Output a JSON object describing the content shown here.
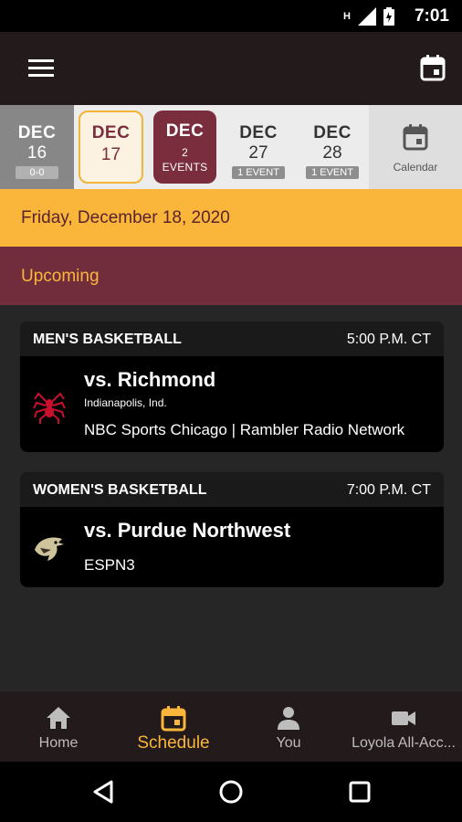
{
  "status_bar": {
    "time": "7:01",
    "network": "H"
  },
  "date_strip": [
    {
      "month": "DEC",
      "day": "16",
      "badge": "0-0"
    },
    {
      "month": "DEC",
      "day": "17",
      "badge": ""
    },
    {
      "month": "DEC",
      "day": "2",
      "badge": "EVENTS"
    },
    {
      "month": "DEC",
      "day": "27",
      "badge": "1 EVENT"
    },
    {
      "month": "DEC",
      "day": "28",
      "badge": "1 EVENT"
    }
  ],
  "calendar_label": "Calendar",
  "date_header": "Friday, December 18, 2020",
  "section_header": "Upcoming",
  "events": [
    {
      "sport": "MEN'S BASKETBALL",
      "time": "5:00 P.M. CT",
      "opponent": "vs. Richmond",
      "location": "Indianapolis, Ind.",
      "broadcast": "NBC Sports Chicago | Rambler Radio Network"
    },
    {
      "sport": "WOMEN'S BASKETBALL",
      "time": "7:00 P.M. CT",
      "opponent": "vs. Purdue Northwest",
      "location": "",
      "broadcast": "ESPN3"
    }
  ],
  "bottom_nav": [
    {
      "label": "Home",
      "icon": "home-icon"
    },
    {
      "label": "Schedule",
      "icon": "calendar-icon",
      "active": true
    },
    {
      "label": "You",
      "icon": "person-icon"
    },
    {
      "label": "Loyola All-Acc...",
      "icon": "video-camera-icon"
    }
  ],
  "colors": {
    "maroon": "#722d3d",
    "gold": "#fab63a",
    "dark": "#231a1c"
  }
}
